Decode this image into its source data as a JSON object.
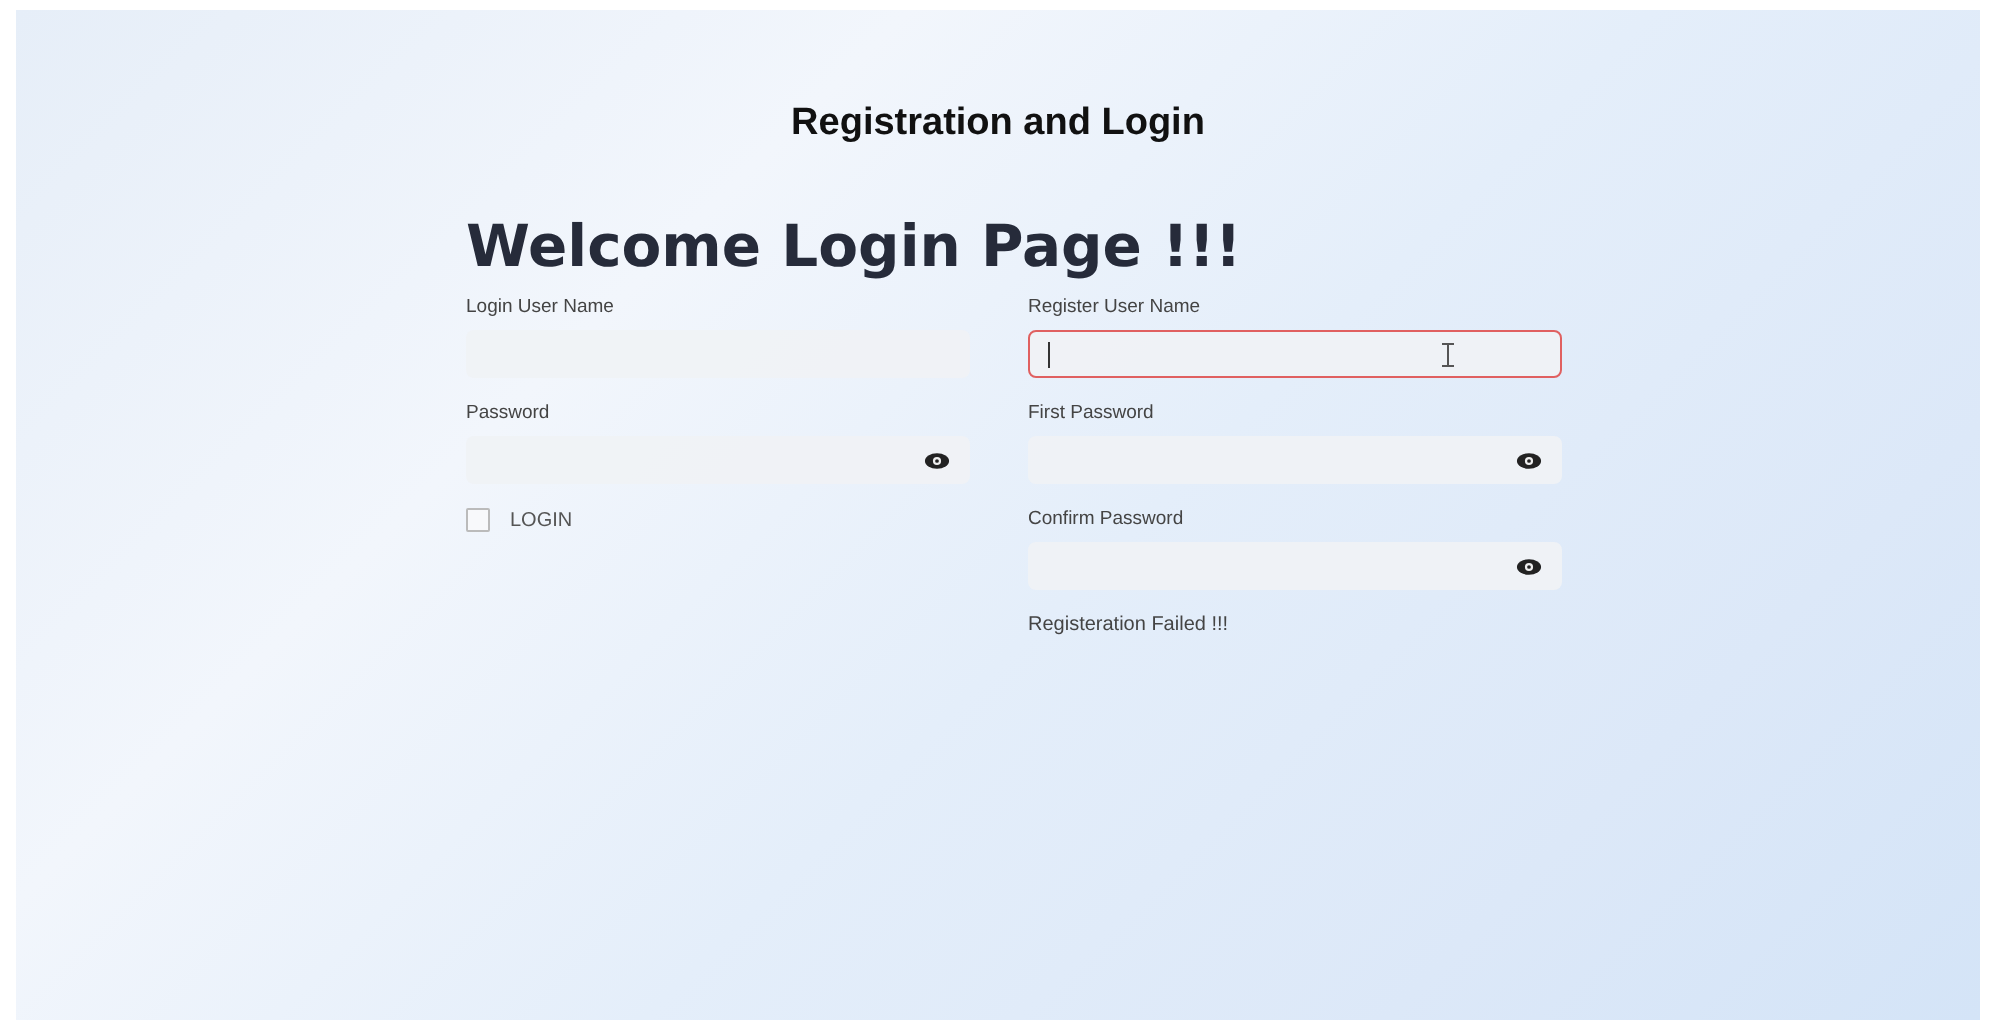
{
  "title": "Registration and Login",
  "heading": "Welcome Login Page !!!",
  "login": {
    "fields": [
      {
        "label": "Login User Name",
        "kind": "text",
        "focused": false
      },
      {
        "label": "Password",
        "kind": "password",
        "focused": false
      }
    ],
    "checkbox": {
      "label": "LOGIN",
      "checked": false
    }
  },
  "register": {
    "fields": [
      {
        "label": "Register User Name",
        "kind": "text",
        "focused": true
      },
      {
        "label": "First Password",
        "kind": "password",
        "focused": false
      },
      {
        "label": "Confirm Password",
        "kind": "password",
        "focused": false
      }
    ],
    "message": "Registeration Failed !!!"
  }
}
